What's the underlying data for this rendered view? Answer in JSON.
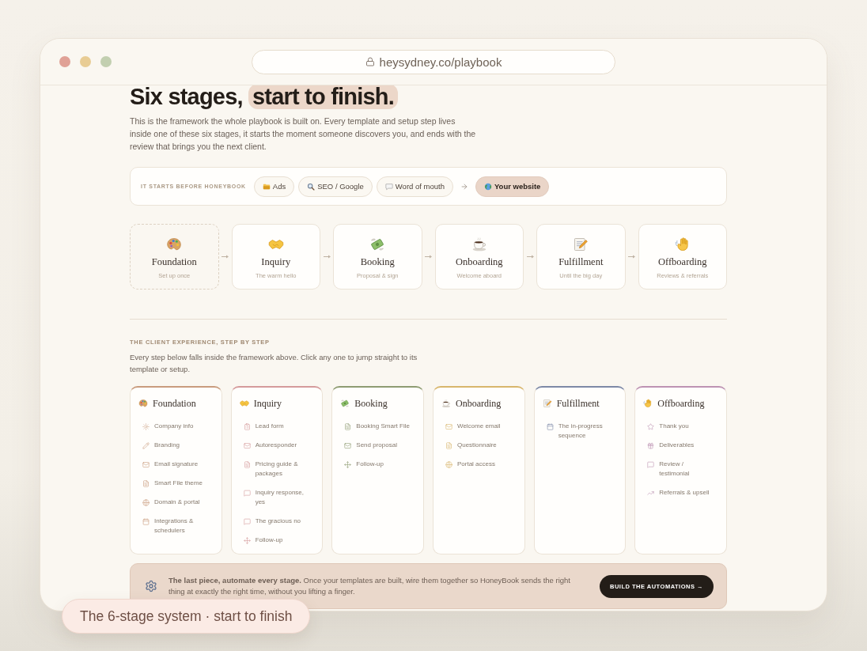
{
  "browser": {
    "url": "heysydney.co/playbook"
  },
  "hero": {
    "title": "Six stages,",
    "title_highlight": "start to finish.",
    "intro": "This is the framework the whole playbook is built on. Every template and setup step lives inside one of these six stages, it starts the moment someone discovers you, and ends with the review that brings you the next client."
  },
  "sources": {
    "label": "IT STARTS BEFORE HONEYBOOK",
    "chips": [
      {
        "label": "Ads",
        "kind": "source"
      },
      {
        "label": "SEO / Google",
        "kind": "source"
      },
      {
        "label": "Word of mouth",
        "kind": "source"
      },
      {
        "label": "Your website",
        "kind": "destination"
      }
    ]
  },
  "stages": [
    {
      "name": "Foundation",
      "subtitle": "Set up once",
      "kind": "setup"
    },
    {
      "name": "Inquiry",
      "subtitle": "The warm hello",
      "kind": "stage"
    },
    {
      "name": "Booking",
      "subtitle": "Proposal & sign",
      "kind": "stage"
    },
    {
      "name": "Onboarding",
      "subtitle": "Welcome aboard",
      "kind": "stage"
    },
    {
      "name": "Fulfillment",
      "subtitle": "Until the big day",
      "kind": "stage"
    },
    {
      "name": "Offboarding",
      "subtitle": "Reviews & referrals",
      "kind": "stage"
    }
  ],
  "client_experience": {
    "label": "THE CLIENT EXPERIENCE, STEP BY STEP",
    "intro": "Every step below falls inside the framework above. Click any one to jump straight to its template or setup.",
    "columns": [
      {
        "name": "Foundation",
        "color": "#c99c7e",
        "steps": [
          {
            "label": "Company info",
            "kind": "info"
          },
          {
            "label": "Branding",
            "kind": "brush"
          },
          {
            "label": "Email signature",
            "kind": "email"
          },
          {
            "label": "Smart File theme",
            "kind": "document"
          },
          {
            "label": "Domain & portal",
            "kind": "web"
          },
          {
            "label": "Integrations & schedulers",
            "kind": "calendar"
          }
        ]
      },
      {
        "name": "Inquiry",
        "color": "#d59b9c",
        "steps": [
          {
            "label": "Lead form",
            "kind": "form"
          },
          {
            "label": "Autoresponder",
            "kind": "email"
          },
          {
            "label": "Pricing guide & packages",
            "kind": "document"
          },
          {
            "label": "Inquiry response, yes",
            "kind": "message"
          },
          {
            "label": "The gracious no",
            "kind": "message"
          },
          {
            "label": "Follow-up",
            "kind": "followup"
          }
        ]
      },
      {
        "name": "Booking",
        "color": "#8e9c72",
        "steps": [
          {
            "label": "Booking Smart File",
            "kind": "document"
          },
          {
            "label": "Send proposal",
            "kind": "email"
          },
          {
            "label": "Follow-up",
            "kind": "followup"
          }
        ]
      },
      {
        "name": "Onboarding",
        "color": "#d8b66c",
        "steps": [
          {
            "label": "Welcome email",
            "kind": "email"
          },
          {
            "label": "Questionnaire",
            "kind": "document"
          },
          {
            "label": "Portal access",
            "kind": "web"
          }
        ]
      },
      {
        "name": "Fulfillment",
        "color": "#7d89a7",
        "steps": [
          {
            "label": "The in-progress sequence",
            "kind": "calendar"
          }
        ]
      },
      {
        "name": "Offboarding",
        "color": "#bd93b3",
        "steps": [
          {
            "label": "Thank you",
            "kind": "star"
          },
          {
            "label": "Deliverables",
            "kind": "gift"
          },
          {
            "label": "Review / testimonial",
            "kind": "message"
          },
          {
            "label": "Referrals & upsell",
            "kind": "growth"
          }
        ]
      }
    ]
  },
  "automation_banner": {
    "text": "**The last piece, automate every stage.** Once your templates are built, wire them together so HoneyBook sends the right thing at exactly the right time, without you lifting a finger.",
    "button": "BUILD THE AUTOMATIONS →"
  },
  "caption": "The 6-stage system · start to finish"
}
